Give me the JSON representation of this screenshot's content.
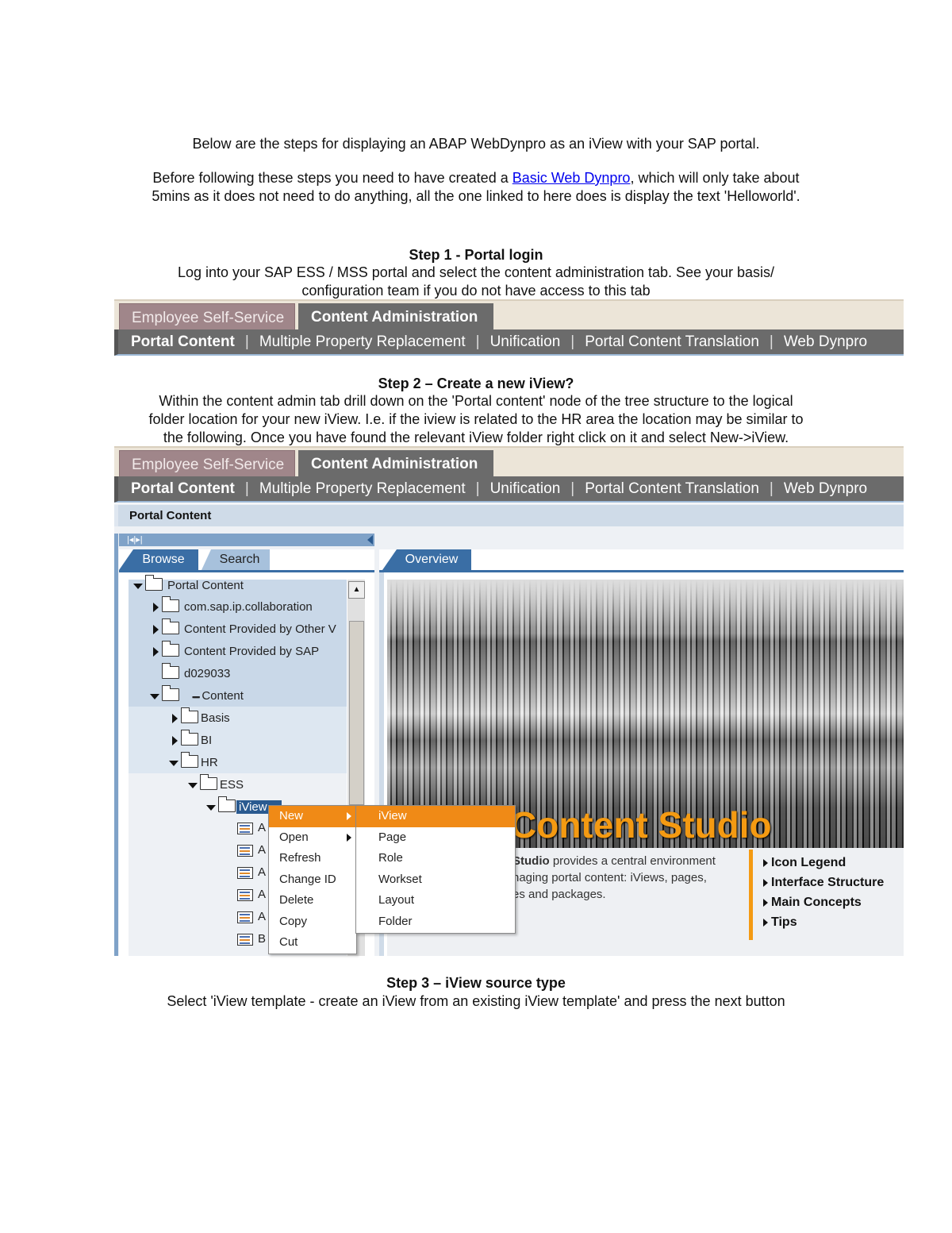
{
  "intro": {
    "line1": "Below are the steps for displaying an ABAP WebDynpro as an iView with your SAP portal.",
    "line2_before": "Before following these steps you need to have created a ",
    "line2_link": "Basic Web Dynpro",
    "line2_after": ", which will only take about",
    "line3": "5mins as it does not need to do anything, all the one linked to here does is display the text 'Helloworld'."
  },
  "step1": {
    "title": "Step 1 - Portal login",
    "text1": "Log into your SAP ESS / MSS portal and select the content administration tab. See your basis/",
    "text2": "configuration team if you do not have access to this tab"
  },
  "step2": {
    "title": "Step 2 – Create a new iView?",
    "text1": "Within the content admin tab drill down on the 'Portal content' node of the tree structure to the logical",
    "text2": "folder location for your new iView. I.e. if the iview is related to the HR area the location may be similar to",
    "text3": "the following. Once you have found the relevant iView folder right click on it and select New->iView."
  },
  "step3": {
    "title": "Step 3 – iView source type",
    "text1": "Select 'iView template - create an iView from an existing iView template' and press the next button"
  },
  "portal": {
    "top_tabs": [
      "Employee Self-Service",
      "Content Administration"
    ],
    "sub_nav": [
      "Portal Content",
      "Multiple Property Replacement",
      "Unification",
      "Portal Content Translation",
      "Web Dynpro"
    ],
    "separator": "|",
    "page_title": "Portal Content",
    "left_tabs": [
      "Browse",
      "Search"
    ],
    "right_tab": "Overview",
    "tree": [
      "Portal Content",
      "com.sap.ip.collaboration",
      "Content Provided by Other V",
      "Content Provided by SAP",
      "d029033",
      "Content",
      "Basis",
      "BI",
      "HR",
      "ESS",
      "iView"
    ],
    "tree_masked": "▪▪▪▪▪▪▪",
    "tree_items": [
      "A",
      "A",
      "A",
      "A",
      "A",
      "B"
    ],
    "context_menu": [
      "New",
      "Open",
      "Refresh",
      "Change ID",
      "Delete",
      "Copy",
      "Cut"
    ],
    "submenu": [
      "iView",
      "Page",
      "Role",
      "Workset",
      "Layout",
      "Folder"
    ],
    "banner_title": "Content Studio",
    "desc_bold": "Studio",
    "desc1": " provides a central environment",
    "desc2": "naging portal content: iViews, pages,",
    "desc3": "es and packages.",
    "links": [
      "Icon Legend",
      "Interface Structure",
      "Main Concepts",
      "Tips"
    ],
    "accent": "#f08a16"
  }
}
